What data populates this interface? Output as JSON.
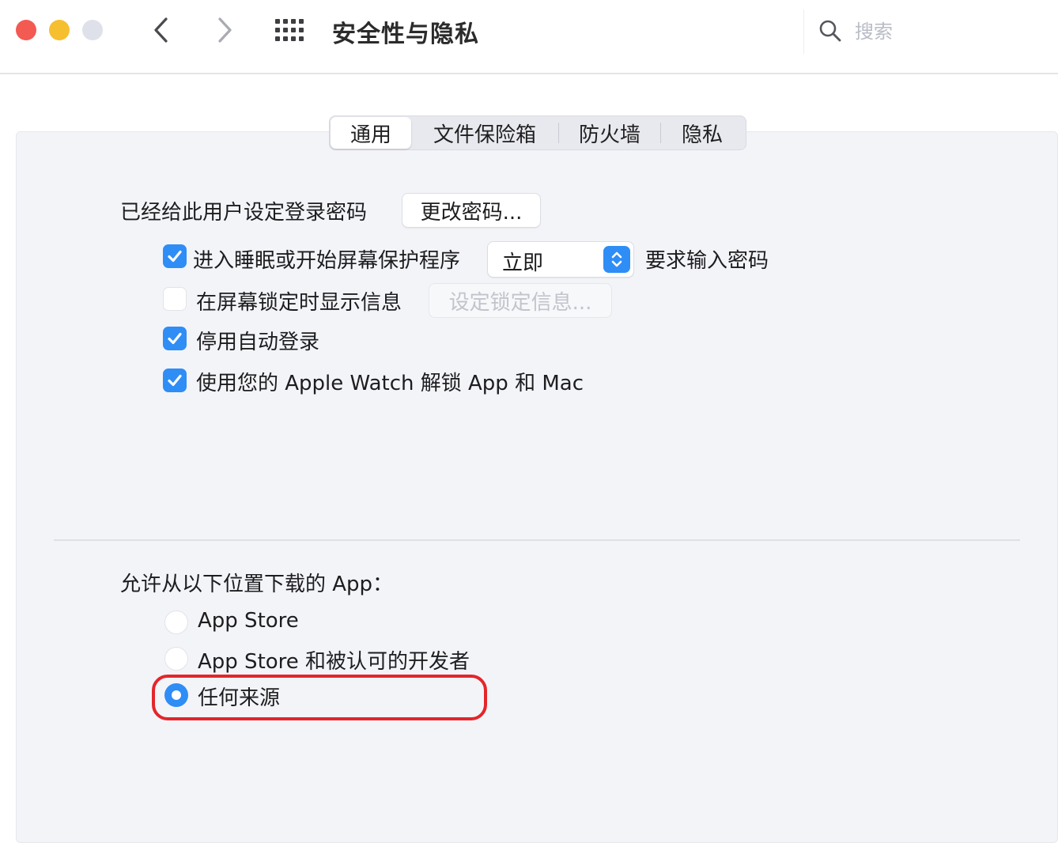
{
  "window": {
    "title": "安全性与隐私",
    "search_placeholder": "搜索"
  },
  "tabs": [
    {
      "label": "通用",
      "active": true
    },
    {
      "label": "文件保险箱",
      "active": false
    },
    {
      "label": "防火墙",
      "active": false
    },
    {
      "label": "隐私",
      "active": false
    }
  ],
  "general": {
    "password_label": "已经给此用户设定登录密码",
    "change_password_button": "更改密码...",
    "require_password": {
      "checked": true,
      "label": "进入睡眠或开始屏幕保护程序",
      "select_value": "立即",
      "suffix": "要求输入密码"
    },
    "lock_message": {
      "checked": false,
      "label": "在屏幕锁定时显示信息",
      "button": "设定锁定信息..."
    },
    "disable_auto_login": {
      "checked": true,
      "label": "停用自动登录"
    },
    "apple_watch_unlock": {
      "checked": true,
      "label": "使用您的 Apple Watch 解锁 App 和 Mac"
    }
  },
  "downloads": {
    "heading": "允许从以下位置下载的 App：",
    "options": [
      {
        "label": "App Store",
        "selected": false
      },
      {
        "label": "App Store 和被认可的开发者",
        "selected": false
      },
      {
        "label": "任何来源",
        "selected": true
      }
    ]
  },
  "colors": {
    "accent": "#2f8df6",
    "highlight": "#e3262b",
    "close": "#f35a52",
    "minimize": "#f6bf30",
    "maximize": "#dfe1ea"
  }
}
